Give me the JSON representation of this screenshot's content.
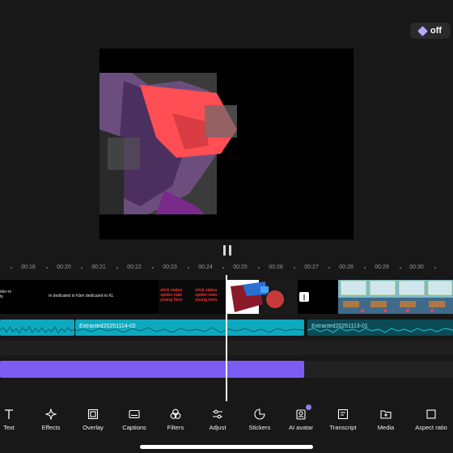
{
  "promo": {
    "label": "off"
  },
  "timeline": {
    "ticks": [
      "00:18",
      "00:20",
      "00:21",
      "00:22",
      "00:23",
      "00:24",
      "00:25",
      "00:26",
      "00:27",
      "00:28",
      "00:29",
      "00:30"
    ],
    "video_captions": [
      "ider-m\nts",
      "m dedicated to Kbm dedicated to KL"
    ],
    "red_text_1": "stick status\nspider-man\nyoung hero",
    "red_text_2": "stick status\nspider-man\nyoung hero",
    "transition_glyph": "|",
    "audio_clip_1": "Extracted20251114-02",
    "audio_clip_2": "Extracted20251113-01"
  },
  "toolbar": [
    {
      "label": "Text",
      "icon": "text-icon"
    },
    {
      "label": "Effects",
      "icon": "effects-icon"
    },
    {
      "label": "Overlay",
      "icon": "overlay-icon"
    },
    {
      "label": "Captions",
      "icon": "captions-icon"
    },
    {
      "label": "Filters",
      "icon": "filters-icon"
    },
    {
      "label": "Adjust",
      "icon": "adjust-icon"
    },
    {
      "label": "Stickers",
      "icon": "stickers-icon"
    },
    {
      "label": "AI avatar",
      "icon": "ai-avatar-icon"
    },
    {
      "label": "Transcript",
      "icon": "transcript-icon"
    },
    {
      "label": "Media",
      "icon": "media-icon"
    },
    {
      "label": "Aspect ratio",
      "icon": "aspect-ratio-icon"
    }
  ],
  "colors": {
    "accent_purple": "#7b5cf5",
    "audio_cyan": "#0fa9bf",
    "background": "#181818"
  }
}
